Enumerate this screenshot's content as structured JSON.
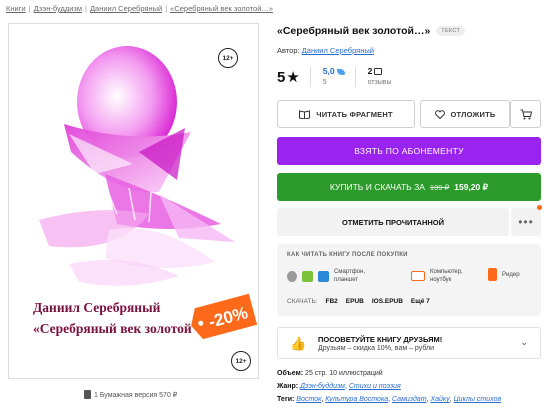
{
  "breadcrumbs": [
    "Книги",
    "Дзэн-буддизм",
    "Даниил Серебряный",
    "«Серебряный век золотой…»"
  ],
  "cover": {
    "age_rating": "12+",
    "author": "Даниил Серебряный",
    "title": "«Серебряный век золотой",
    "discount": "-20%"
  },
  "paper_version": "1 Бумажная версия 570 ₽",
  "book": {
    "title": "«Серебряный век золотой…»",
    "type_badge": "ТЕКСТ",
    "author_label": "Автор:",
    "author": "Даниил Серебряный"
  },
  "rating": {
    "score": "5",
    "avg": "5,0",
    "votes": "5",
    "reviews": "2",
    "reviews_label": "отзывы"
  },
  "buttons": {
    "read_fragment": "ЧИТАТЬ ФРАГМЕНТ",
    "postpone": "ОТЛОЖИТЬ",
    "subscribe": "ВЗЯТЬ ПО АБОНЕМЕНТУ",
    "buy_label": "КУПИТЬ И СКАЧАТЬ ЗА",
    "old_price": "199 ₽",
    "new_price": "159,20 ₽",
    "mark_read": "ОТМЕТИТЬ ПРОЧИТАННОЙ",
    "more": "•••"
  },
  "howto": {
    "heading": "КАК ЧИТАТЬ КНИГУ ПОСЛЕ ПОКУПКИ",
    "phone": [
      "Смартфон,",
      "планшет"
    ],
    "pc": [
      "Компьютер,",
      "ноутбук"
    ],
    "reader": "Ридер",
    "download_label": "СКАЧАТЬ:",
    "formats": [
      "FB2",
      "EPUB",
      "IOS.EPUB",
      "Ещё 7"
    ]
  },
  "recommend": {
    "title": "ПОСОВЕТУЙТЕ КНИГУ ДРУЗЬЯМ!",
    "subtitle": "Друзьям – скидка 10%, вам – рубли"
  },
  "meta": {
    "volume_label": "Объем:",
    "volume": "25 стр. 10 иллюстраций",
    "genre_label": "Жанр:",
    "genres": [
      "Дзэн-буддизм",
      "Стихи и поэзия"
    ],
    "tags_label": "Теги:",
    "tags": [
      "Восток",
      "Культура Востока",
      "Самиздат",
      "Хайку",
      "Циклы стихов"
    ]
  },
  "colors": {
    "subscribe": "#9b23f0",
    "buy": "#2c9b2c",
    "link": "#2a6dd0",
    "discount": "#ff6a1a",
    "cover_magenta": "#e83ce0"
  }
}
